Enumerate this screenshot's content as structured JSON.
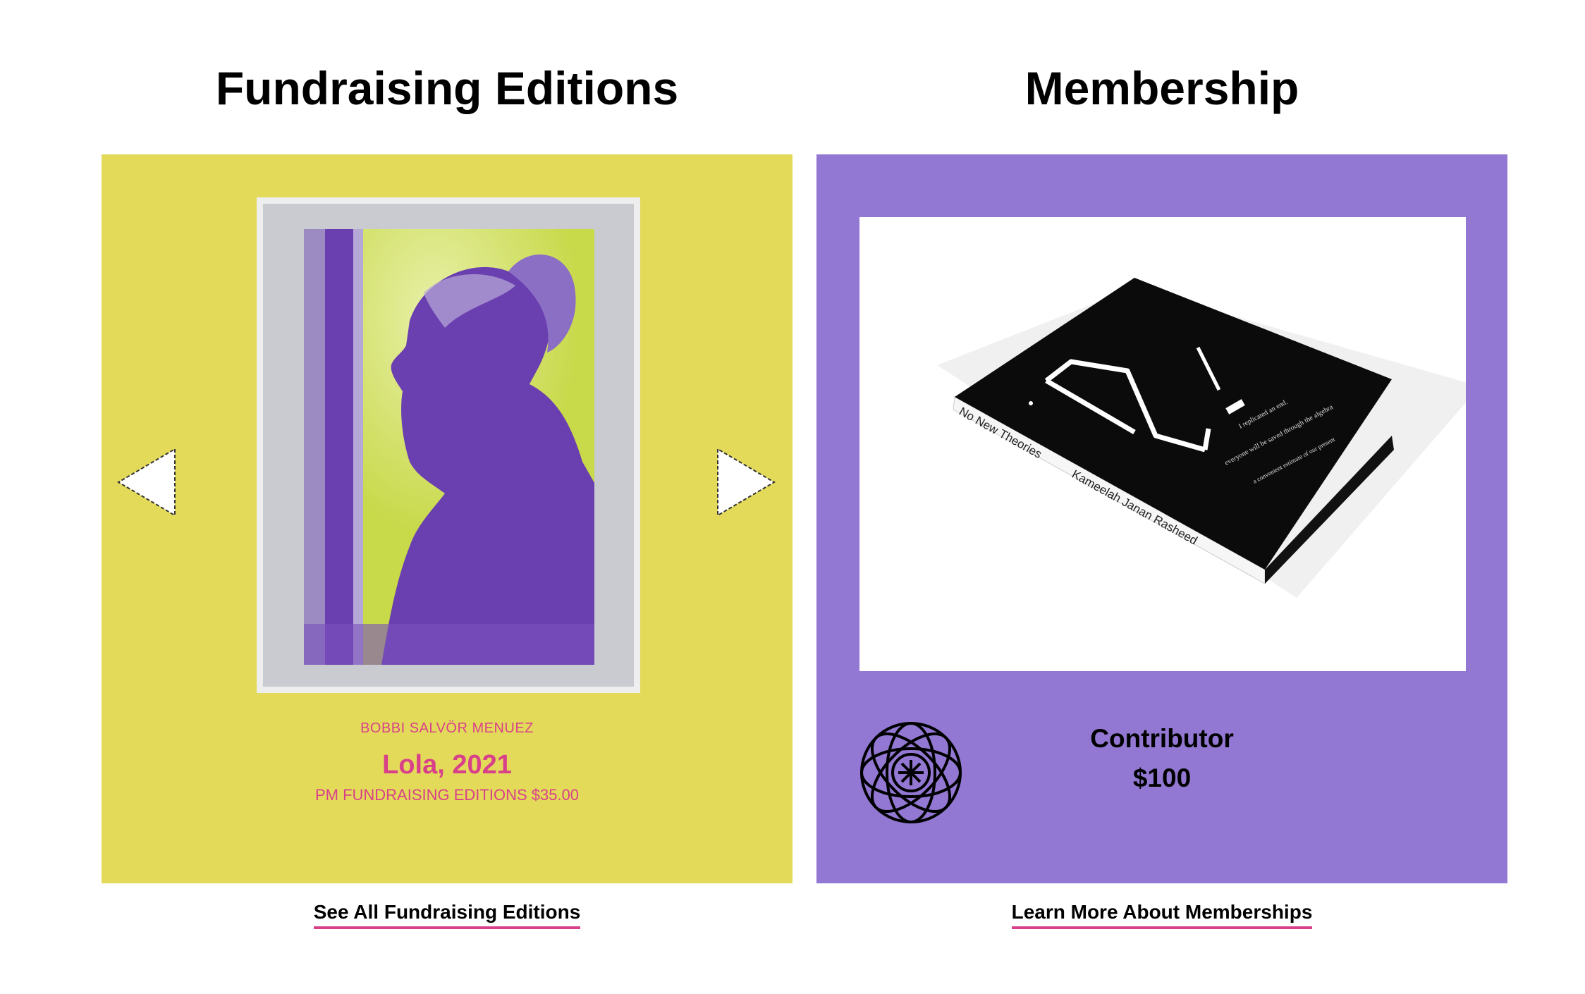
{
  "fundraising": {
    "title": "Fundraising Editions",
    "item": {
      "artist": "BOBBI SALVÖR MENUEZ",
      "title": "Lola, 2021",
      "edition_price": "PM FUNDRAISING EDITIONS $35.00"
    },
    "see_all_label": "See All Fundraising Editions"
  },
  "membership": {
    "title": "Membership",
    "book": {
      "spine_title": "No New Theories",
      "spine_author": "Kameelah Janan Rasheed",
      "cover_line_1": "I replicated an end.",
      "cover_line_2": "everyone will be saved through the algebra",
      "cover_line_3": "a convenient estimate of our present"
    },
    "tier": {
      "name": "Contributor",
      "price": "$100"
    },
    "learn_more_label": "Learn More About Memberships"
  },
  "colors": {
    "fundraising_panel": "#e3da5a",
    "membership_panel": "#9278d2",
    "accent_pink": "#d8418a"
  },
  "icons": {
    "prev": "triangle-left-icon",
    "next": "triangle-right-icon",
    "membership": "orbit-star-icon"
  }
}
